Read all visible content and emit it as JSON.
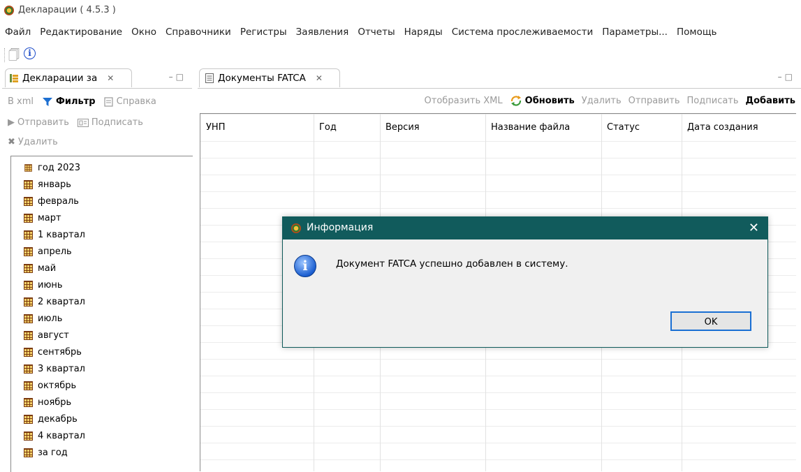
{
  "app": {
    "title": "Декларации ( 4.5.3 )"
  },
  "menu": [
    "Файл",
    "Редактирование",
    "Окно",
    "Справочники",
    "Регистры",
    "Заявления",
    "Отчеты",
    "Наряды",
    "Система прослеживаемости",
    "Параметры...",
    "Помощь"
  ],
  "left_panel": {
    "tab_title": "Декларации за",
    "toolbar": {
      "bxml": "B xml",
      "filter": "Фильтр",
      "help": "Справка",
      "send": "Отправить",
      "sign": "Подписать",
      "delete": "Удалить"
    },
    "tree": [
      "год 2023",
      "январь",
      "февраль",
      "март",
      "1 квартал",
      "апрель",
      "май",
      "июнь",
      "2 квартал",
      "июль",
      "август",
      "сентябрь",
      "3 квартал",
      "октябрь",
      "ноябрь",
      "декабрь",
      "4 квартал",
      "за год"
    ]
  },
  "right_panel": {
    "tab_title": "Документы FATCA",
    "toolbar": {
      "show_xml": "Отобразить XML",
      "refresh": "Обновить",
      "delete": "Удалить",
      "send": "Отправить",
      "sign": "Подписать",
      "add": "Добавить"
    },
    "columns": [
      "УНП",
      "Год",
      "Версия",
      "Название файла",
      "Статус",
      "Дата создания"
    ]
  },
  "dialog": {
    "title": "Информация",
    "message": "Документ FATCA успешно добавлен в систему.",
    "ok": "OK"
  }
}
